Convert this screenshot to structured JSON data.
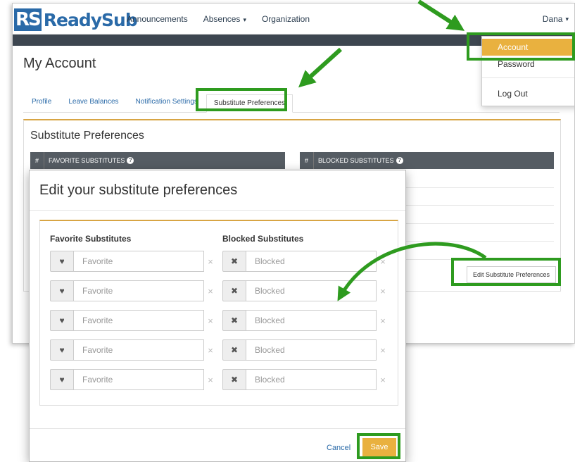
{
  "app": {
    "logo_mark": "RS",
    "logo_text": "ReadySub"
  },
  "nav": {
    "items": [
      {
        "label": "Announcements"
      },
      {
        "label": "Absences",
        "caret": "▾"
      },
      {
        "label": "Organization"
      }
    ],
    "user": "Dana",
    "user_caret": "▾"
  },
  "user_menu": {
    "items": [
      "Account",
      "Password",
      "Log Out"
    ],
    "active": "Account"
  },
  "page": {
    "title": "My Account",
    "tabs": [
      "Profile",
      "Leave Balances",
      "Notification Settings",
      "Substitute Preferences"
    ],
    "active_tab": "Substitute Preferences"
  },
  "panel": {
    "title": "Substitute Preferences",
    "favorite_header": {
      "num": "#",
      "label": "Favorite Substitutes",
      "icon": "info-icon"
    },
    "blocked_header": {
      "num": "#",
      "label": "Blocked Substitutes",
      "icon": "info-icon"
    },
    "edit_button": "Edit Substitute Preferences"
  },
  "modal": {
    "title": "Edit your substitute preferences",
    "favorite_label": "Favorite Substitutes",
    "blocked_label": "Blocked Substitutes",
    "favorite_placeholder": "Favorite",
    "blocked_placeholder": "Blocked",
    "favorite_icon": "heart-icon",
    "blocked_icon": "times-icon",
    "clear_glyph": "×",
    "row_count": 5,
    "cancel": "Cancel",
    "save": "Save"
  },
  "colors": {
    "brand": "#2a6aa8",
    "accent": "#e9b13f",
    "highlight": "#2e9b1f",
    "table_header": "#555c63"
  }
}
